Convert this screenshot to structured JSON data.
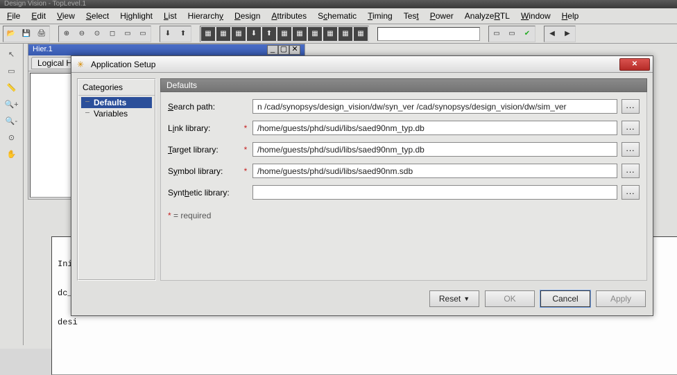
{
  "main_window": {
    "title": "Design Vision - TopLevel.1"
  },
  "menu": [
    "File",
    "Edit",
    "View",
    "Select",
    "Highlight",
    "List",
    "Hierarchy",
    "Design",
    "Attributes",
    "Schematic",
    "Timing",
    "Test",
    "Power",
    "AnalyzeRTL",
    "Window",
    "Help"
  ],
  "hier_window": {
    "title": "Hier.1",
    "tab": "Logical H"
  },
  "log_lines": [
    "Init",
    "dc_s",
    "desi"
  ],
  "dialog": {
    "title": "Application Setup",
    "categories_header": "Categories",
    "categories": [
      {
        "label": "Defaults",
        "selected": true
      },
      {
        "label": "Variables",
        "selected": false
      }
    ],
    "section_title": "Defaults",
    "fields": {
      "search_path": {
        "label": "Search path:",
        "required": false,
        "value": "n /cad/synopsys/design_vision/dw/syn_ver /cad/synopsys/design_vision/dw/sim_ver"
      },
      "link_library": {
        "label": "Link library:",
        "required": true,
        "value": "/home/guests/phd/sudi/libs/saed90nm_typ.db"
      },
      "target_library": {
        "label": "Target library:",
        "required": true,
        "value": "/home/guests/phd/sudi/libs/saed90nm_typ.db"
      },
      "symbol_library": {
        "label": "Symbol library:",
        "required": true,
        "value": "/home/guests/phd/sudi/libs/saed90nm.sdb"
      },
      "synthetic_library": {
        "label": "Synthetic library:",
        "required": false,
        "value": ""
      }
    },
    "required_note": " = required",
    "buttons": {
      "reset": "Reset",
      "ok": "OK",
      "cancel": "Cancel",
      "apply": "Apply"
    }
  }
}
